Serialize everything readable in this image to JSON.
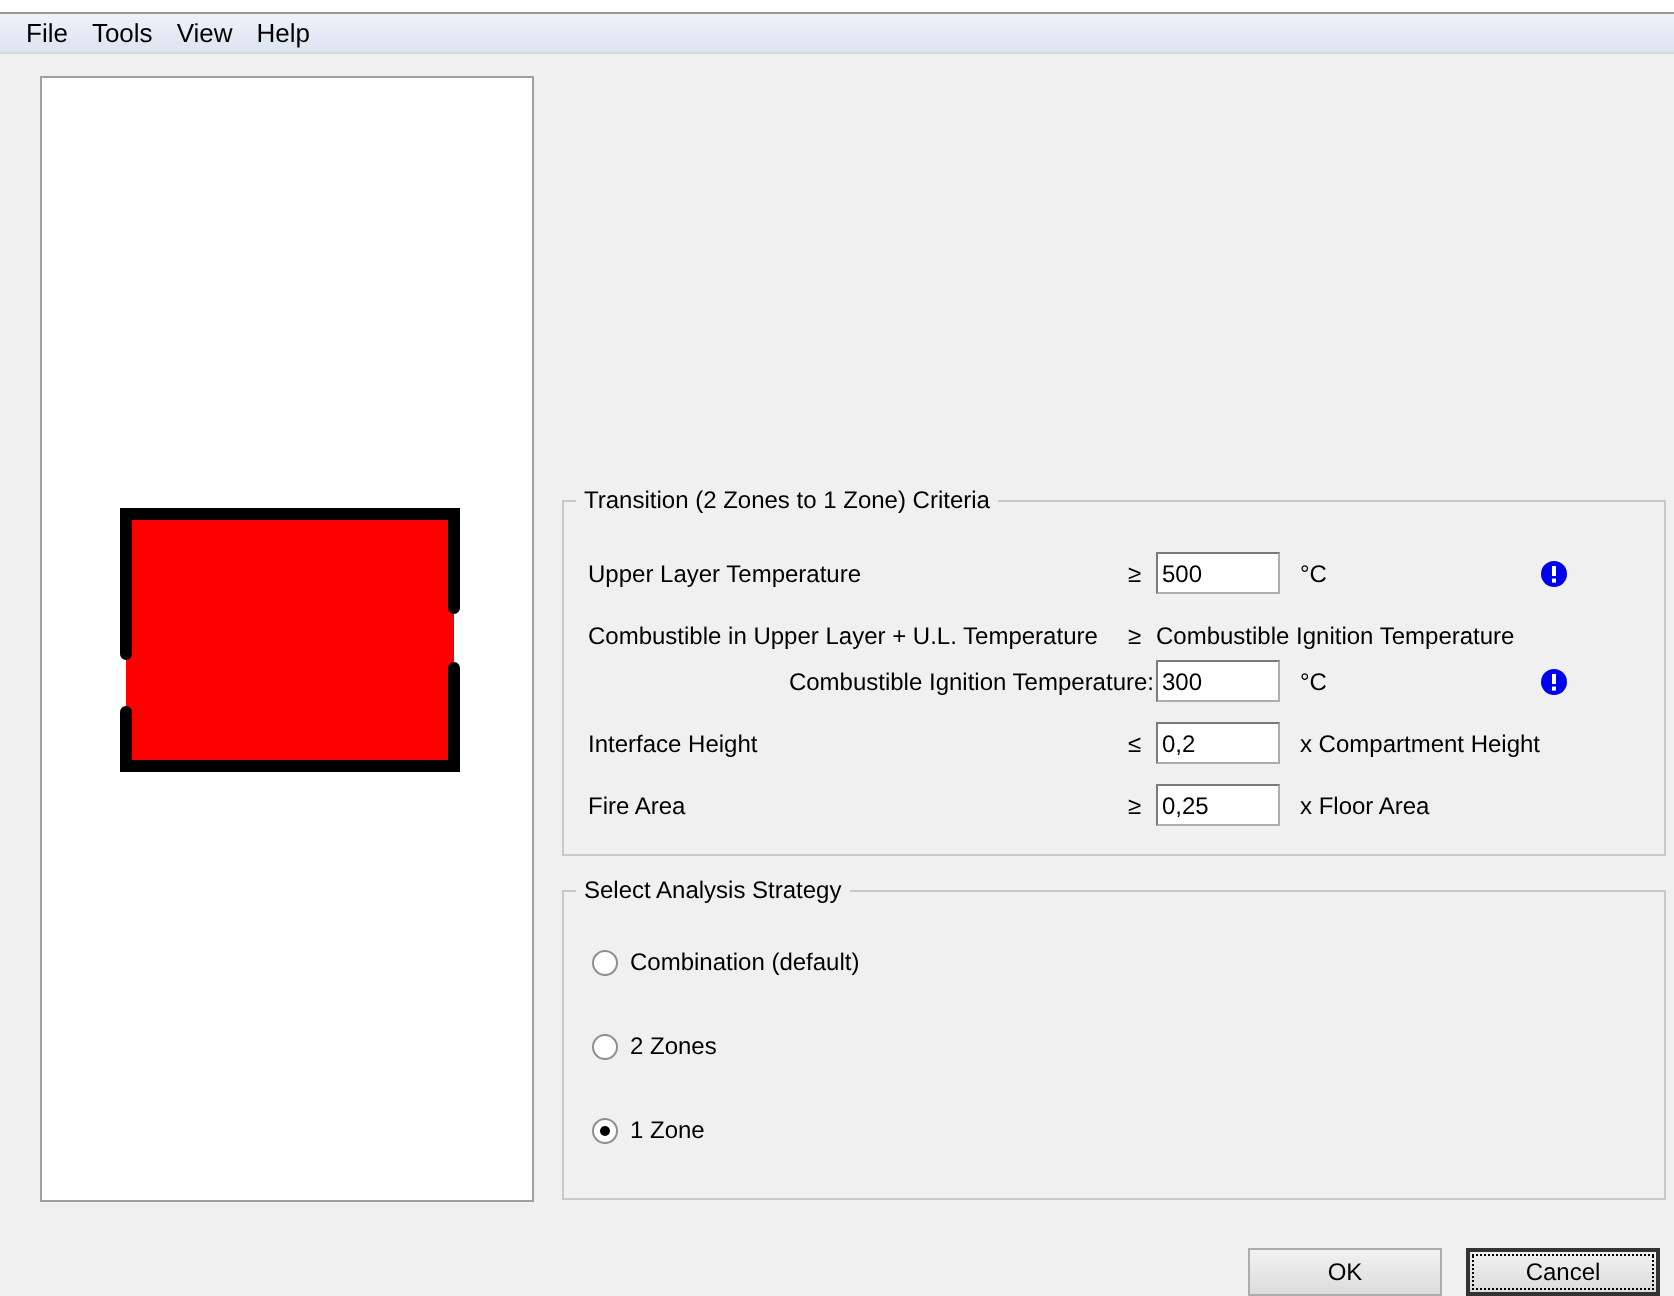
{
  "menu": [
    "File",
    "Tools",
    "View",
    "Help"
  ],
  "preview": {
    "kind": "room"
  },
  "criteria": {
    "title": "Transition (2 Zones to 1 Zone) Criteria",
    "rows": [
      {
        "kind": "input",
        "label": "Upper Layer Temperature",
        "operator": "≥",
        "value": "500",
        "unit": "°C",
        "warning": true
      },
      {
        "kind": "statement",
        "label": "Combustible in Upper Layer + U.L. Temperature",
        "operator": "≥",
        "unit": "Combustible Ignition Temperature",
        "warning": false
      },
      {
        "kind": "sub",
        "label": "Combustible Ignition Temperature:",
        "value": "300",
        "unit": "°C",
        "warning": true
      },
      {
        "kind": "input",
        "label": "Interface Height",
        "operator": "≤",
        "value": "0,2",
        "unit": "x Compartment Height",
        "warning": false
      },
      {
        "kind": "input",
        "label": "Fire Area",
        "operator": "≥",
        "value": "0,25",
        "unit": "x Floor Area",
        "warning": false
      }
    ]
  },
  "strategy": {
    "title": "Select Analysis Strategy",
    "options": [
      {
        "label": "Combination (default)",
        "selected": false
      },
      {
        "label": "2 Zones",
        "selected": false
      },
      {
        "label": "1 Zone",
        "selected": true
      }
    ]
  },
  "buttons": [
    {
      "label": "OK",
      "focused": false
    },
    {
      "label": "Cancel",
      "focused": true
    }
  ]
}
